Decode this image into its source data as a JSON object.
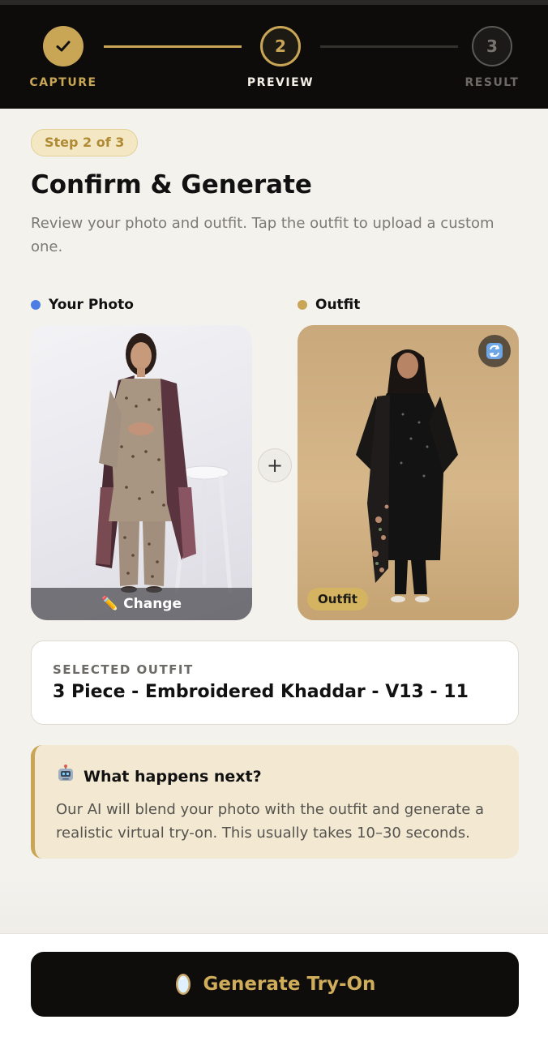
{
  "stepper": {
    "steps": [
      {
        "label": "CAPTURE",
        "number": "✓",
        "state": "done"
      },
      {
        "label": "PREVIEW",
        "number": "2",
        "state": "active"
      },
      {
        "label": "RESULT",
        "number": "3",
        "state": "pending"
      }
    ]
  },
  "badge": "Step 2 of 3",
  "title": "Confirm & Generate",
  "subtitle": "Review your photo and outfit. Tap the outfit to upload a custom one.",
  "photo": {
    "section_label": "Your Photo",
    "change_label": "Change",
    "change_icon": "pencil-icon"
  },
  "outfit": {
    "section_label": "Outfit",
    "tag": "Outfit",
    "swap_icon": "swap-icon"
  },
  "plus_icon": "+",
  "selected_outfit": {
    "caption": "SELECTED OUTFIT",
    "name": "3 Piece - Embroidered Khaddar - V13 - 11"
  },
  "info": {
    "icon": "robot-icon",
    "heading": "What happens next?",
    "body": "Our AI will blend your photo with the outfit and generate a realistic virtual try-on. This usually takes 10–30 seconds."
  },
  "cta": {
    "label": "Generate Try-On",
    "icon": "mirror-icon"
  },
  "colors": {
    "accent_gold": "#c8a655",
    "header_bg": "#0d0c0b",
    "photo_dot": "#4b7de3",
    "page_bg": "#f4f2ed"
  }
}
